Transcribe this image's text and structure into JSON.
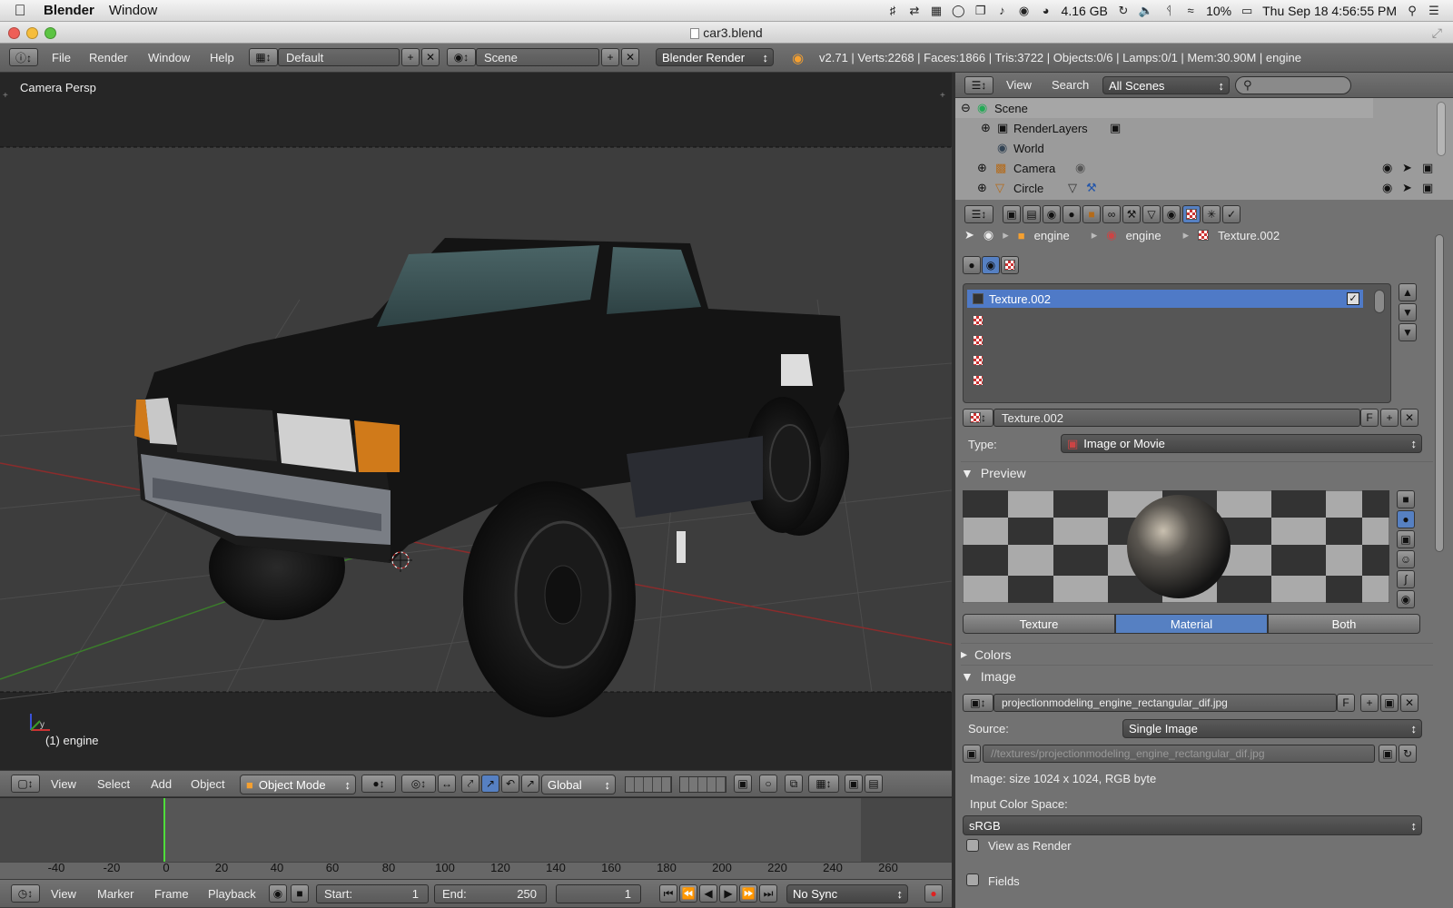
{
  "macos_menubar": {
    "app_name": "Blender",
    "menu_window": "Window",
    "memory": "4.16 GB",
    "battery": "10%",
    "datetime": "Thu Sep 18  4:56:55 PM"
  },
  "window": {
    "title": "car3.blend"
  },
  "info_header": {
    "menus": [
      "File",
      "Render",
      "Window",
      "Help"
    ],
    "screen_layout": "Default",
    "scene": "Scene",
    "render_engine": "Blender Render",
    "stats": "v2.71 | Verts:2268 | Faces:1866 | Tris:3722 | Objects:0/6 | Lamps:0/1 | Mem:30.90M | engine"
  },
  "viewport": {
    "view_label": "Camera Persp",
    "object_label": "(1) engine",
    "axis_y": "y",
    "header": {
      "menus": [
        "View",
        "Select",
        "Add",
        "Object"
      ],
      "mode": "Object Mode",
      "orientation": "Global"
    }
  },
  "timeline": {
    "ticks": [
      "-40",
      "-20",
      "0",
      "20",
      "40",
      "60",
      "80",
      "100",
      "120",
      "140",
      "160",
      "180",
      "200",
      "220",
      "240",
      "260"
    ],
    "menus": [
      "View",
      "Marker",
      "Frame",
      "Playback"
    ],
    "start_label": "Start:",
    "start_value": "1",
    "end_label": "End:",
    "end_value": "250",
    "current_frame": "1",
    "sync": "No Sync"
  },
  "outliner": {
    "menus": [
      "View",
      "Search"
    ],
    "filter": "All Scenes",
    "items": [
      "Scene",
      "RenderLayers",
      "World",
      "Camera",
      "Circle"
    ]
  },
  "properties": {
    "breadcrumb": [
      "engine",
      "engine",
      "Texture.002"
    ],
    "texture_slots": [
      "Texture.002"
    ],
    "texture_name": "Texture.002",
    "texture_name_f": "F",
    "type_label": "Type:",
    "type_value": "Image or Movie",
    "preview_label": "Preview",
    "preview_tabs": [
      "Texture",
      "Material",
      "Both"
    ],
    "colors_label": "Colors",
    "image_label": "Image",
    "image_name": "projectionmodeling_engine_rectangular_dif.jpg",
    "image_f": "F",
    "source_label": "Source:",
    "source_value": "Single Image",
    "filepath": "//textures/projectionmodeling_engine_rectangular_dif.jpg",
    "image_info": "Image: size 1024 x 1024, RGB byte",
    "color_space_label": "Input Color Space:",
    "color_space_value": "sRGB",
    "view_as_render": "View as Render",
    "fields": "Fields"
  },
  "colors": {
    "accent_blue": "#5680c2",
    "selection": "#4f7ac7"
  }
}
